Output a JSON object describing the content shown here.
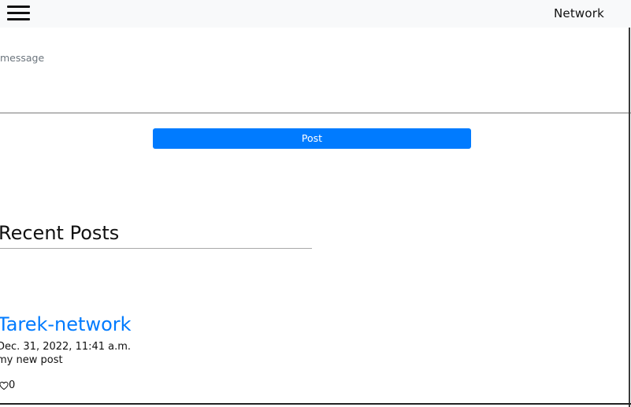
{
  "navbar": {
    "brand": "Network",
    "menu_icon": "hamburger-menu-icon"
  },
  "compose": {
    "placeholder": "message",
    "value": "",
    "submit_label": "Post"
  },
  "recent": {
    "title": "Recent Posts"
  },
  "posts": [
    {
      "author": "Tarek-network",
      "timestamp": "Dec. 31, 2022, 11:41 a.m.",
      "content": "my new post",
      "like_icon": "heart-outline-icon",
      "likes": "0"
    }
  ],
  "colors": {
    "accent": "#007bff",
    "navbar_bg": "#f8f9fa"
  }
}
